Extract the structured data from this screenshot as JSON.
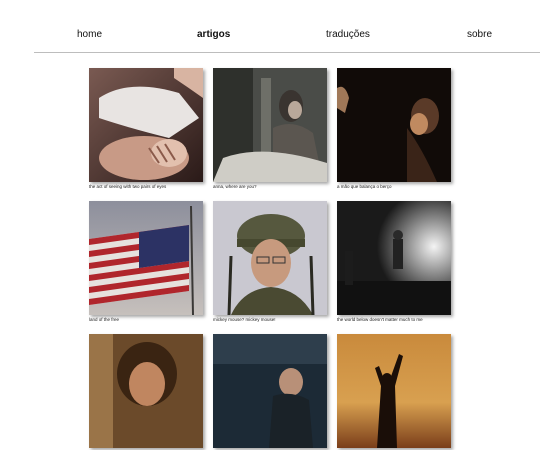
{
  "nav": {
    "items": [
      {
        "label": "home",
        "active": false
      },
      {
        "label": "artigos",
        "active": true
      },
      {
        "label": "traduções",
        "active": false
      },
      {
        "label": "sobre",
        "active": false
      }
    ]
  },
  "gallery": {
    "items": [
      {
        "caption": "the act of seeing with two pairs of eyes"
      },
      {
        "caption": "anna, where are you?"
      },
      {
        "caption": "a mão que balança o berço"
      },
      {
        "caption": "land of the free"
      },
      {
        "caption": "mickey mouse? mickey mouse!"
      },
      {
        "caption": "the world below doesn't matter much to me"
      },
      {
        "caption": ""
      },
      {
        "caption": ""
      },
      {
        "caption": ""
      }
    ]
  }
}
